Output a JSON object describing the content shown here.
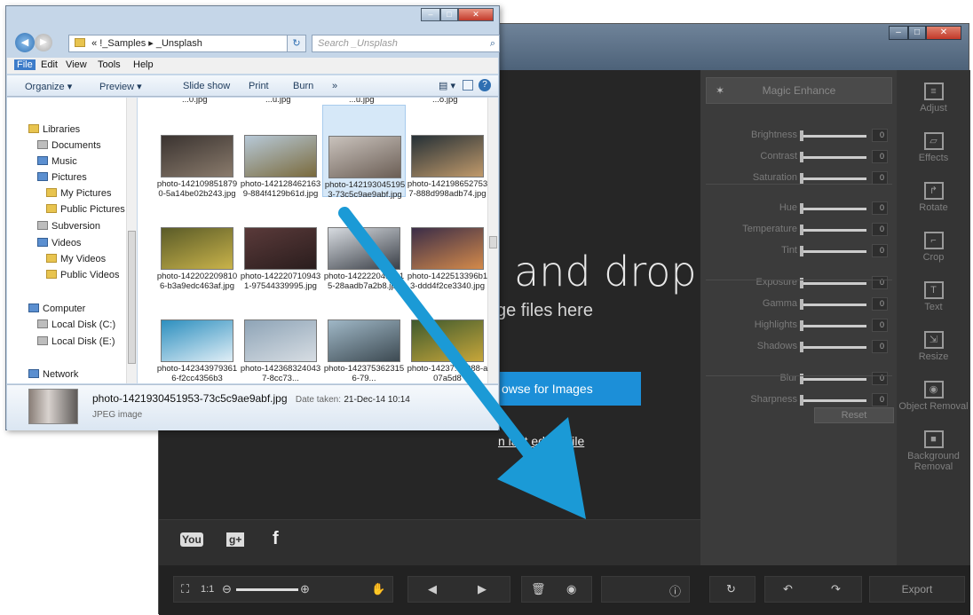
{
  "editor": {
    "drag_title": "and drop",
    "drag_subtitle": "ge files here",
    "browse_label": "owse for Images",
    "open_last_label": "n last edited file",
    "magic_enhance": "Magic Enhance",
    "sliders": [
      {
        "label": "Brightness",
        "value": "0"
      },
      {
        "label": "Contrast",
        "value": "0"
      },
      {
        "label": "Saturation",
        "value": "0"
      },
      {
        "label": "Hue",
        "value": "0"
      },
      {
        "label": "Temperature",
        "value": "0"
      },
      {
        "label": "Tint",
        "value": "0"
      },
      {
        "label": "Exposure",
        "value": "0"
      },
      {
        "label": "Gamma",
        "value": "0"
      },
      {
        "label": "Highlights",
        "value": "0"
      },
      {
        "label": "Shadows",
        "value": "0"
      },
      {
        "label": "Blur",
        "value": "0"
      },
      {
        "label": "Sharpness",
        "value": "0"
      }
    ],
    "reset_label": "Reset",
    "tools": [
      {
        "label": "Adjust",
        "icon": "adjust-icon"
      },
      {
        "label": "Effects",
        "icon": "effects-icon"
      },
      {
        "label": "Rotate",
        "icon": "rotate-icon"
      },
      {
        "label": "Crop",
        "icon": "crop-icon"
      },
      {
        "label": "Text",
        "icon": "text-icon"
      },
      {
        "label": "Resize",
        "icon": "resize-icon"
      },
      {
        "label": "Object Removal",
        "icon": "object-removal-icon"
      },
      {
        "label": "Background Removal",
        "icon": "background-removal-icon"
      }
    ],
    "zoom_label": "1:1",
    "export_label": "Export",
    "social": {
      "youtube": "You",
      "gplus": "g+",
      "facebook": "f"
    }
  },
  "explorer": {
    "breadcrumb": "« !_Samples ▸ _Unsplash",
    "search_placeholder": "Search _Unsplash",
    "menu": [
      "File",
      "Edit",
      "View",
      "Tools",
      "Help"
    ],
    "commands": [
      "Organize ▾",
      "Preview ▾",
      "Slide show",
      "Print",
      "Burn",
      "»"
    ],
    "nav": [
      {
        "label": "Libraries",
        "kind": "folder"
      },
      {
        "label": "Documents",
        "kind": "grey"
      },
      {
        "label": "Music",
        "kind": "blue"
      },
      {
        "label": "Pictures",
        "kind": "blue"
      },
      {
        "label": "My Pictures",
        "kind": "folder"
      },
      {
        "label": "Public Pictures",
        "kind": "folder"
      },
      {
        "label": "Subversion",
        "kind": "grey"
      },
      {
        "label": "Videos",
        "kind": "blue"
      },
      {
        "label": "My Videos",
        "kind": "folder"
      },
      {
        "label": "Public Videos",
        "kind": "folder"
      },
      {
        "label": "Computer",
        "kind": "blue"
      },
      {
        "label": "Local Disk (C:)",
        "kind": "grey"
      },
      {
        "label": "Local Disk (E:)",
        "kind": "grey"
      },
      {
        "label": "Network",
        "kind": "blue"
      }
    ],
    "top_partials": [
      "...0.jpg",
      "...u.jpg",
      "...u.jpg",
      "...o.jpg"
    ],
    "files": [
      {
        "caption": "photo-1421098518790-5a14be02b243.jpg",
        "color1": "#3a3330",
        "color2": "#8a7b6c"
      },
      {
        "caption": "photo-1421284621639-884f4129b61d.jpg",
        "color1": "#b7c9d8",
        "color2": "#7a6a3c"
      },
      {
        "caption": "photo-1421930451953-73c5c9ae9abf.jpg",
        "color1": "#c9c2bc",
        "color2": "#6b5e55",
        "selected": true
      },
      {
        "caption": "photo-1421986527537-888d998adb74.jpg",
        "color1": "#253036",
        "color2": "#c19a6b"
      },
      {
        "caption": "photo-1422022098106-b3a9edc463af.jpg",
        "color1": "#5a5b28",
        "color2": "#c9b34a"
      },
      {
        "caption": "photo-1422207109431-97544339995.jpg",
        "color1": "#5a3a3a",
        "color2": "#2a1d1d"
      },
      {
        "caption": "photo-1422220418315-28aadb7a2b8.jpg",
        "color1": "#d7dbe0",
        "color2": "#3a3f47"
      },
      {
        "caption": "photo-1422513396b13-ddd4f2ce3340.jpg",
        "color1": "#3b2d48",
        "color2": "#d48a4a"
      },
      {
        "caption": "photo-1423439793616-f2cc4356b3",
        "color1": "#2d8fbf",
        "color2": "#e0eef6"
      },
      {
        "caption": "photo-1423683240437-8cc73...",
        "color1": "#8ea4b7",
        "color2": "#d7dde3"
      },
      {
        "caption": "photo-1423753623156-79...",
        "color1": "#9fb7c6",
        "color2": "#3d4a52"
      },
      {
        "caption": "photo-14237...1088-a07a5d8",
        "color1": "#3f5a2e",
        "color2": "#c7a63a"
      }
    ],
    "details": {
      "name": "photo-1421930451953-73c5c9ae9abf.jpg",
      "date_label": "Date taken:",
      "date": "21-Dec-14 10:14",
      "type": "JPEG image"
    }
  }
}
